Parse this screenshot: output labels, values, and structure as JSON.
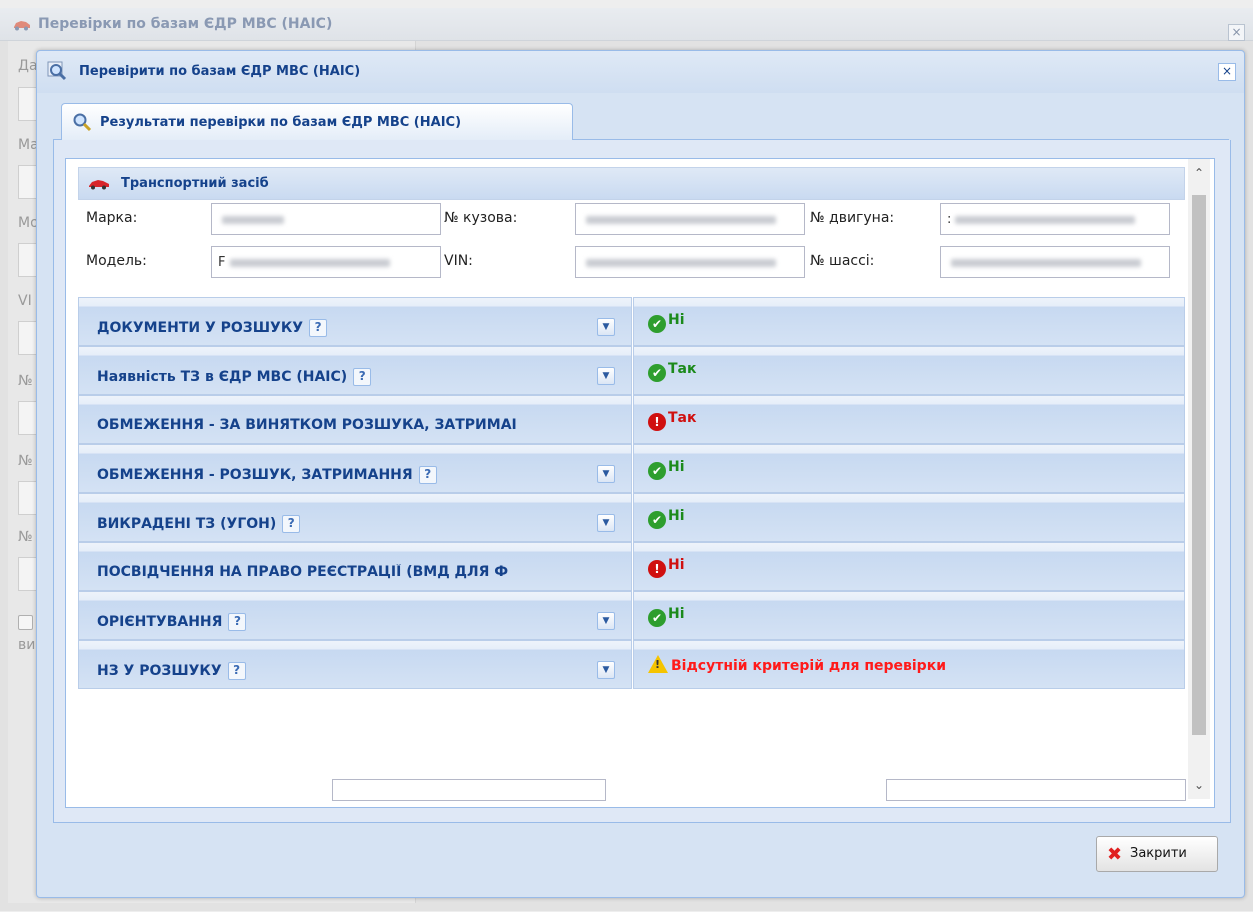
{
  "outer_window": {
    "title": "Перевірки по базам ЄДР МВС (НАІС)",
    "close_glyph": "×",
    "ghost_labels": [
      "Да",
      "Ма",
      "Мо",
      "VI",
      "№",
      "№",
      "№",
      "ви"
    ]
  },
  "dialog": {
    "title": "Перевірити по базам ЄДР МВС (НАІС)",
    "close_glyph": "×",
    "tab_label": "Результати перевірки по базам ЄДР МВС (НАІС)"
  },
  "vehicle": {
    "section_title": "Транспортний засіб",
    "fields": {
      "brand_label": "Марка:",
      "body_no_label": "№ кузова:",
      "engine_no_label": "№ двигуна:",
      "model_label": "Модель:",
      "vin_label": "VIN:",
      "chassis_no_label": "№ шассі:",
      "model_lead": "F",
      "engine_lead": ":"
    }
  },
  "checks": [
    {
      "title": "ДОКУМЕНТИ У РОЗШУКУ",
      "help": "?",
      "dropdown": "▼",
      "status": "Ні",
      "state": "ok",
      "icon": "check-circle-icon"
    },
    {
      "title": "Наявність ТЗ в ЄДР МВС (НАІС)",
      "help": "?",
      "dropdown": "▼",
      "status": "Так",
      "state": "ok",
      "icon": "check-circle-icon"
    },
    {
      "title": "ОБМЕЖЕННЯ - ЗА ВИНЯТКОМ РОЗШУКА, ЗАТРИМАІ",
      "status": "Так",
      "state": "bad",
      "icon": "exclamation-circle-icon"
    },
    {
      "title": "ОБМЕЖЕННЯ - РОЗШУК, ЗАТРИМАННЯ",
      "help": "?",
      "dropdown": "▼",
      "status": "Ні",
      "state": "ok",
      "icon": "check-circle-icon"
    },
    {
      "title": "ВИКРАДЕНІ ТЗ (УГОН)",
      "help": "?",
      "dropdown": "▼",
      "status": "Ні",
      "state": "ok",
      "icon": "check-circle-icon"
    },
    {
      "title": "ПОСВІДЧЕННЯ НА ПРАВО РЕЄСТРАЦІЇ (ВМД ДЛЯ Ф",
      "status": "Ні",
      "state": "bad",
      "icon": "exclamation-circle-icon"
    },
    {
      "title": "ОРІЄНТУВАННЯ",
      "help": "?",
      "dropdown": "▼",
      "status": "Ні",
      "state": "ok",
      "icon": "check-circle-icon"
    },
    {
      "title": "НЗ У РОЗШУКУ",
      "help": "?",
      "dropdown": "▼",
      "status": "Відсутній критерій для перевірки",
      "state": "warn",
      "icon": "warning-triangle-icon"
    }
  ],
  "icons": {
    "check": "✔",
    "exclaim": "!",
    "warn": "!"
  },
  "scroll": {
    "up": "⌃",
    "down": "⌄"
  },
  "footer": {
    "close_label": "Закрити",
    "close_icon": "✖"
  },
  "colors": {
    "accent": "#15428b",
    "ok": "#1b8a1b",
    "bad": "#d01010",
    "warn": "#ff1a1a",
    "border": "#99bbe8"
  }
}
